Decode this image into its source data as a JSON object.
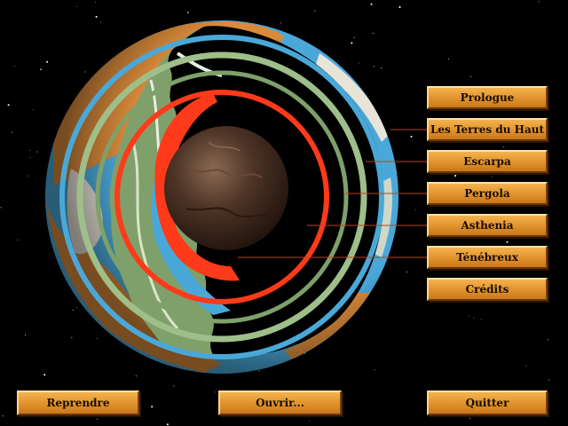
{
  "menu": {
    "items": [
      {
        "id": "prologue",
        "label": "Prologue"
      },
      {
        "id": "terres-du-haut",
        "label": "Les Terres du Haut"
      },
      {
        "id": "escarpa",
        "label": "Escarpa"
      },
      {
        "id": "pergola",
        "label": "Pergola"
      },
      {
        "id": "asthenia",
        "label": "Asthenia"
      },
      {
        "id": "tenebreux",
        "label": "Ténébreux"
      },
      {
        "id": "credits",
        "label": "Crédits"
      }
    ]
  },
  "bottom_bar": {
    "resume_label": "Reprendre",
    "open_label": "Ouvrir...",
    "quit_label": "Quitter"
  },
  "colors": {
    "button_face": "#e0922c",
    "button_text": "#1a0d00",
    "ocean": "#4aa8d8",
    "continent": "#d98a3a",
    "crust_green": "#7fa06a",
    "mantle_red": "#ff3a1a",
    "core": "#4a3020",
    "connector_line": "#b8422a"
  }
}
